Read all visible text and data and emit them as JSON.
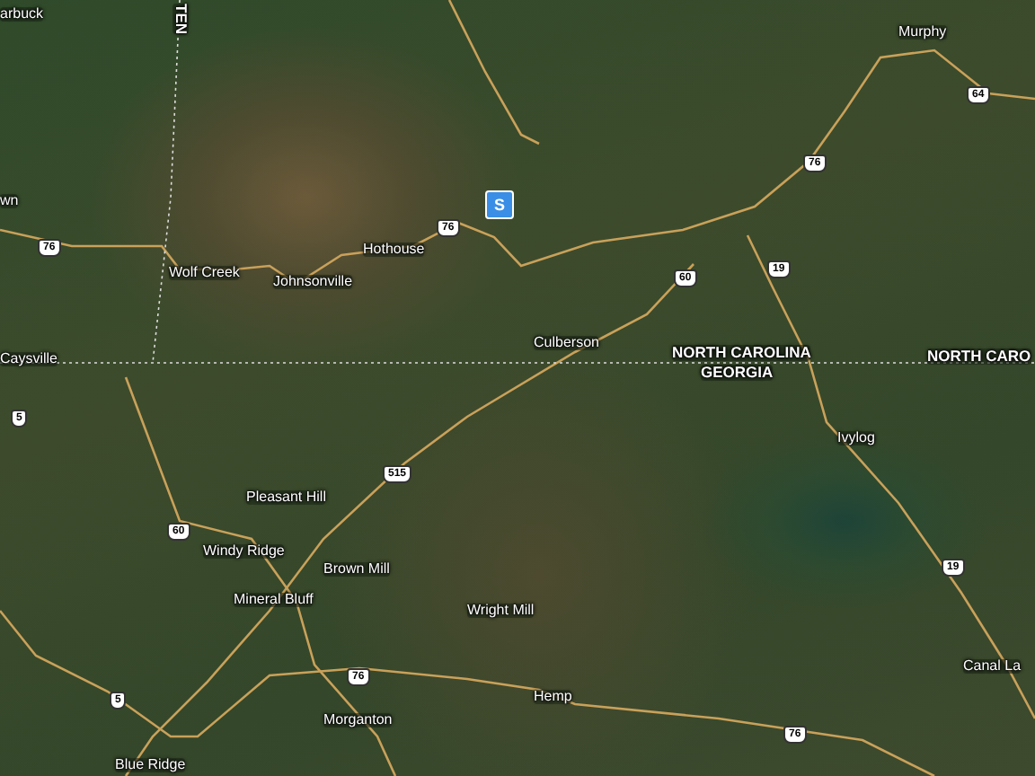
{
  "map": {
    "place_labels": [
      {
        "text": "arbuck"
      },
      {
        "text": "wn"
      },
      {
        "text": "Wolf Creek"
      },
      {
        "text": "Johnsonville"
      },
      {
        "text": "Hothouse"
      },
      {
        "text": "Murphy"
      },
      {
        "text": "Culberson"
      },
      {
        "text": "Caysville"
      },
      {
        "text": "Ivylog"
      },
      {
        "text": "Pleasant Hill"
      },
      {
        "text": "Windy Ridge"
      },
      {
        "text": "Brown Mill"
      },
      {
        "text": "Mineral Bluff"
      },
      {
        "text": "Wright Mill"
      },
      {
        "text": "Canal La"
      },
      {
        "text": "Morganton"
      },
      {
        "text": "Hemp"
      },
      {
        "text": "Blue Ridge"
      }
    ],
    "state_labels": [
      {
        "text": "TEN",
        "kind": "vertical"
      },
      {
        "text": "NORTH CAROLINA",
        "kind": "horizontal"
      },
      {
        "text": "GEORGIA",
        "kind": "horizontal"
      },
      {
        "text": "NORTH CARO",
        "kind": "horizontal"
      }
    ],
    "route_shields": [
      {
        "number": "76"
      },
      {
        "number": "76"
      },
      {
        "number": "64"
      },
      {
        "number": "76"
      },
      {
        "number": "60"
      },
      {
        "number": "19"
      },
      {
        "number": "5"
      },
      {
        "number": "60"
      },
      {
        "number": "515"
      },
      {
        "number": "5"
      },
      {
        "number": "76"
      },
      {
        "number": "19"
      },
      {
        "number": "76"
      }
    ],
    "marker": {
      "label": "S"
    }
  }
}
